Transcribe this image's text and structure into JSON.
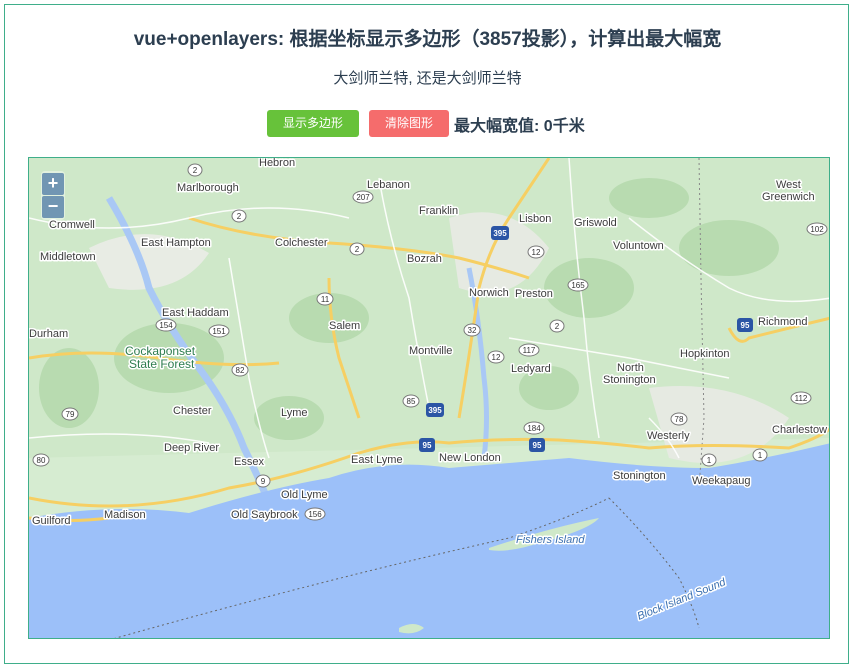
{
  "header": {
    "title": "vue+openlayers: 根据坐标显示多边形（3857投影），计算出最大幅宽",
    "subtitle": "大剑师兰特, 还是大剑师兰特"
  },
  "toolbar": {
    "show_label": "显示多边形",
    "clear_label": "清除图形",
    "result_label": "最大幅宽值:",
    "result_value": "0千米"
  },
  "map": {
    "zoom_in": "+",
    "zoom_out": "−",
    "places": [
      "Hebron",
      "Marlborough",
      "Lebanon",
      "Franklin",
      "Lisbon",
      "Griswold",
      "West Greenwich",
      "Cromwell",
      "East Hampton",
      "Colchester",
      "Bozrah",
      "Voluntown",
      "Middletown",
      "Norwich",
      "Preston",
      "East Haddam",
      "Salem",
      "Richmond",
      "Durham",
      "Montville",
      "Hopkinton",
      "Ledyard",
      "North Stonington",
      "Chester",
      "Lyme",
      "Westerly",
      "Deep River",
      "Charlestow",
      "Essex",
      "East Lyme",
      "New London",
      "Stonington",
      "Weekapaug",
      "Old Lyme",
      "Madison",
      "Old Saybrook",
      "Guilford"
    ],
    "green_label": "Cockaponset State Forest",
    "water_labels": [
      "Fishers Island",
      "Block Island Sound"
    ],
    "routes": [
      "2",
      "207",
      "2",
      "395",
      "12",
      "165",
      "11",
      "32",
      "2",
      "102",
      "154",
      "151",
      "82",
      "117",
      "12",
      "95",
      "85",
      "395",
      "79",
      "184",
      "95",
      "78",
      "112",
      "80",
      "1",
      "1",
      "9",
      "156",
      "95"
    ]
  },
  "colors": {
    "green_button": "#67c23a",
    "red_button": "#f56c6c",
    "border": "#3fae8a",
    "water": "#9cc0f9",
    "land": "#cfe8c9"
  }
}
